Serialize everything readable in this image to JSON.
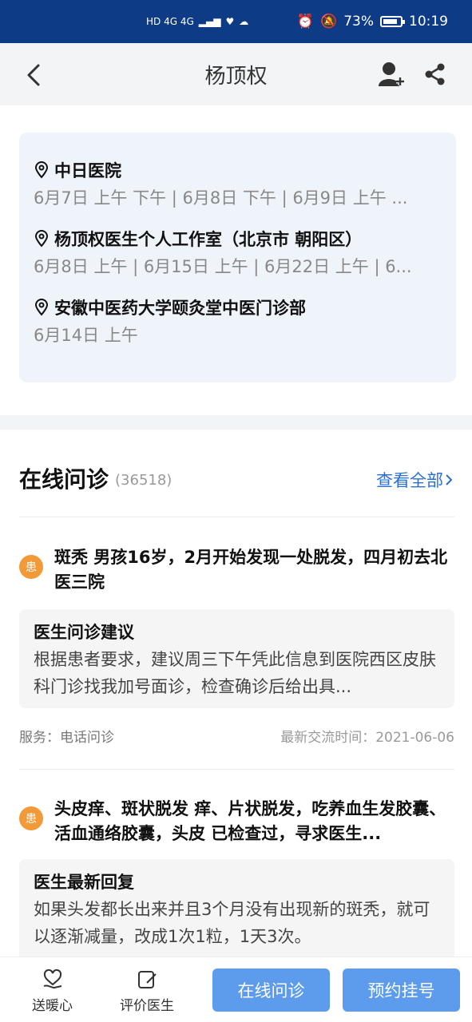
{
  "status_bar": {
    "network": "HD 4G 4G",
    "battery": "73%",
    "time": "10:19"
  },
  "nav": {
    "title": "杨顶权"
  },
  "schedule": [
    {
      "name": "中日医院",
      "times": "6月7日 上午 下午 | 6月8日 下午 | 6月9日 上午 ..."
    },
    {
      "name": "杨顶权医生个人工作室（北京市 朝阳区）",
      "times": "6月8日 上午 | 6月15日 上午 | 6月22日 上午 | 6..."
    },
    {
      "name": "安徽中医药大学颐灸堂中医门诊部",
      "times": "6月14日 上午"
    }
  ],
  "online_consult": {
    "title": "在线问诊",
    "count": "(36518)",
    "view_all": "查看全部"
  },
  "items": [
    {
      "badge": "患",
      "title": "斑秃 男孩16岁，2月开始发现一处脱发，四月初去北医三院",
      "reply_label": "医生问诊建议",
      "reply_text": "根据患者要求，建议周三下午凭此信息到医院西区皮肤科门诊找我加号面诊，检查确诊后给出具...",
      "service": "服务：电话问诊",
      "time": "最新交流时间：2021-06-06"
    },
    {
      "badge": "患",
      "title": "头皮痒、斑状脱发 痒、片状脱发，吃养血生发胶囊、活血通络胶囊，头皮 已检查过，寻求医生...",
      "reply_label": "医生最新回复",
      "reply_text": "如果头发都长出来并且3个月没有出现新的斑秃，就可以逐渐减量，改成1次1粒，1天3次。"
    }
  ],
  "bottom": {
    "warm_heart": "送暖心",
    "rate_doctor": "评价医生",
    "online_consult_btn": "在线问诊",
    "appointment_btn": "预约挂号"
  },
  "colors": {
    "status_bar": "#0d3b86",
    "accent_link": "#2a6fd6",
    "primary_button": "#5d9cec",
    "patient_badge": "#f39a38"
  }
}
